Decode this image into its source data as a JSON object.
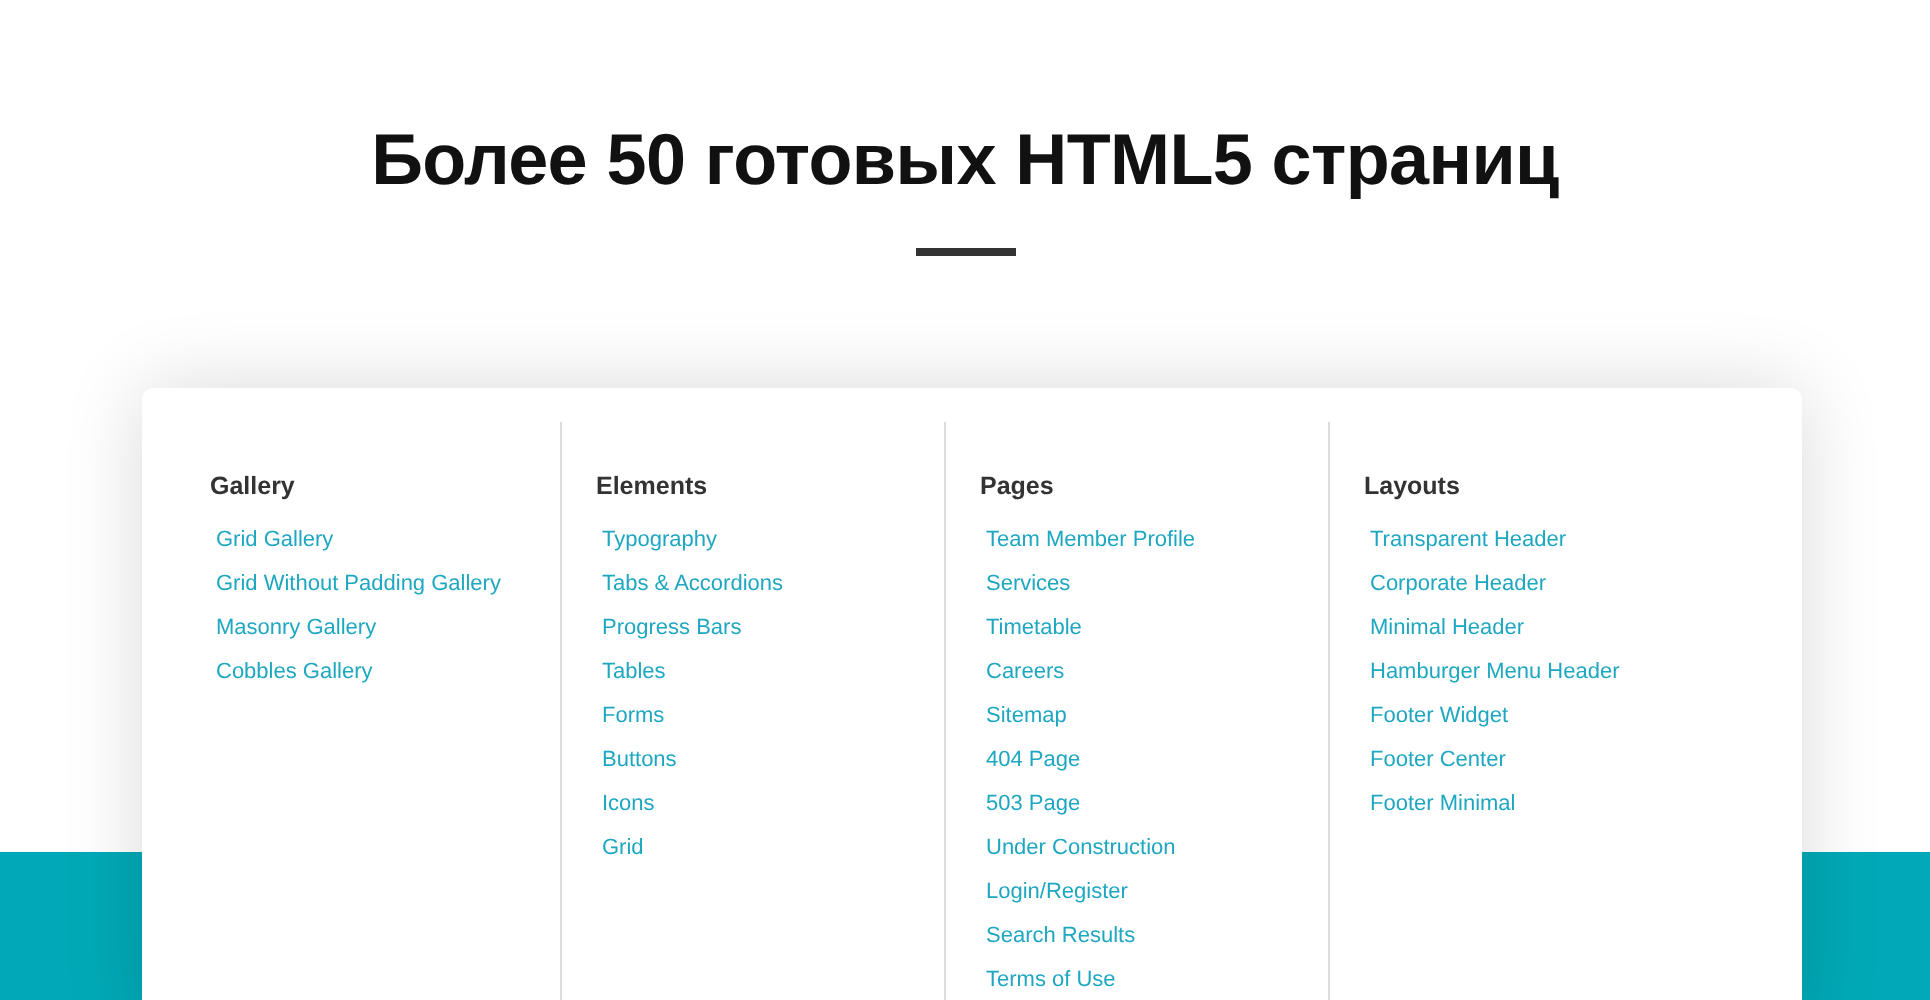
{
  "title": "Более 50 готовых HTML5 страниц",
  "columns": [
    {
      "heading": "Gallery",
      "links": [
        "Grid Gallery",
        "Grid Without Padding Gallery",
        "Masonry Gallery",
        "Cobbles Gallery"
      ]
    },
    {
      "heading": "Elements",
      "links": [
        "Typography",
        "Tabs & Accordions",
        "Progress Bars",
        "Tables",
        "Forms",
        "Buttons",
        "Icons",
        "Grid"
      ]
    },
    {
      "heading": "Pages",
      "links": [
        "Team Member Profile",
        "Services",
        "Timetable",
        "Careers",
        "Sitemap",
        "404 Page",
        "503 Page",
        "Under Construction",
        "Login/Register",
        "Search Results",
        "Terms of Use"
      ]
    },
    {
      "heading": "Layouts",
      "links": [
        "Transparent Header",
        "Corporate Header",
        "Minimal Header",
        "Hamburger Menu Header",
        "Footer Widget",
        "Footer Center",
        "Footer Minimal"
      ]
    }
  ]
}
